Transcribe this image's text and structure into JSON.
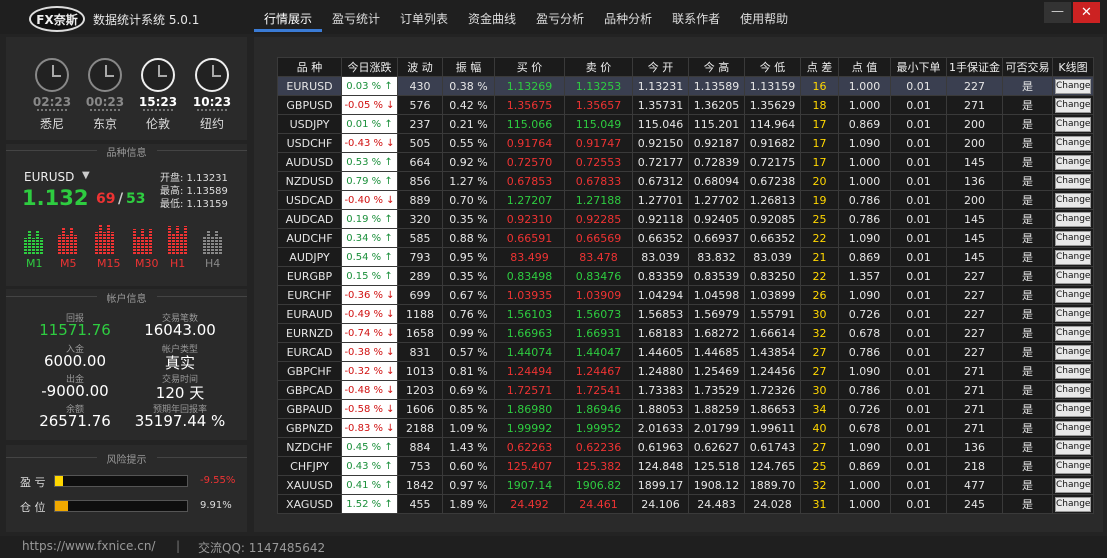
{
  "app": {
    "logo": "FX奈斯",
    "title": "数据统计系统 5.0.1"
  },
  "nav": [
    "行情展示",
    "盈亏统计",
    "订单列表",
    "资金曲线",
    "盈亏分析",
    "品种分析",
    "联系作者",
    "使用帮助"
  ],
  "window_buttons": {
    "minimize": "—",
    "close": "✕"
  },
  "clocks": [
    {
      "time": "02:23",
      "city": "悉尼",
      "active": false
    },
    {
      "time": "00:23",
      "city": "东京",
      "active": false
    },
    {
      "time": "15:23",
      "city": "伦敦",
      "active": true
    },
    {
      "time": "10:23",
      "city": "纽约",
      "active": true
    }
  ],
  "symbol_panel": {
    "title": "品种信息",
    "symbol": "EURUSD",
    "price_main": "1.132",
    "price_r1": "69",
    "price_sep": "/",
    "price_r2": "53",
    "open": "开盘: 1.13231",
    "high": "最高: 1.13589",
    "low": "最低: 1.13159",
    "timeframes": [
      "M1",
      "M5",
      "M15",
      "M30",
      "H1",
      "H4"
    ],
    "tf_colors": [
      "#2ecc40",
      "#e33",
      "#e33",
      "#e33",
      "#e33",
      "#888"
    ]
  },
  "account": {
    "title": "帐户信息",
    "items": [
      {
        "label": "回报",
        "value": "11571.76",
        "color": "#2ecc40"
      },
      {
        "label": "交易笔数",
        "value": "16043.00",
        "color": "#fff"
      },
      {
        "label": "入金",
        "value": "6000.00",
        "color": "#fff"
      },
      {
        "label": "帐户类型",
        "value": "真实",
        "color": "#fff"
      },
      {
        "label": "出金",
        "value": "-9000.00",
        "color": "#fff"
      },
      {
        "label": "交易时间",
        "value": "120 天",
        "color": "#fff"
      },
      {
        "label": "余额",
        "value": "26571.76",
        "color": "#fff"
      },
      {
        "label": "预期年回报率",
        "value": "35197.44 %",
        "color": "#fff"
      }
    ]
  },
  "risk": {
    "title": "风险提示",
    "profit_label": "盈 亏",
    "profit_value": "-9.55%",
    "profit_level": 0.06,
    "position_label": "仓 位",
    "position_value": "9.91%",
    "position_level": 0.0991
  },
  "table": {
    "headers": [
      "品 种",
      "今日涨跌",
      "波 动",
      "振 幅",
      "买 价",
      "卖 价",
      "今 开",
      "今 高",
      "今 低",
      "点 差",
      "点 值",
      "最小下单",
      "1手保证金",
      "可否交易",
      "K线图"
    ],
    "change_label": "Change",
    "rows": [
      [
        "EURUSD",
        "0.03 % ↑",
        "up",
        "430",
        "0.38 %",
        "1.13269",
        "1.13253",
        "1.13231",
        "1.13589",
        "1.13159",
        "16",
        "1.000",
        "0.01",
        "227",
        "是"
      ],
      [
        "GBPUSD",
        "-0.05 % ↓",
        "dn",
        "576",
        "0.42 %",
        "1.35675",
        "1.35657",
        "1.35731",
        "1.36205",
        "1.35629",
        "18",
        "1.000",
        "0.01",
        "271",
        "是"
      ],
      [
        "USDJPY",
        "0.01 % ↑",
        "up",
        "237",
        "0.21 %",
        "115.066",
        "115.049",
        "115.046",
        "115.201",
        "114.964",
        "17",
        "0.869",
        "0.01",
        "200",
        "是"
      ],
      [
        "USDCHF",
        "-0.43 % ↓",
        "dn",
        "505",
        "0.55 %",
        "0.91764",
        "0.91747",
        "0.92150",
        "0.92187",
        "0.91682",
        "17",
        "1.090",
        "0.01",
        "200",
        "是"
      ],
      [
        "AUDUSD",
        "0.53 % ↑",
        "dn",
        "664",
        "0.92 %",
        "0.72570",
        "0.72553",
        "0.72177",
        "0.72839",
        "0.72175",
        "17",
        "1.000",
        "0.01",
        "145",
        "是"
      ],
      [
        "NZDUSD",
        "0.79 % ↑",
        "dn",
        "856",
        "1.27 %",
        "0.67853",
        "0.67833",
        "0.67312",
        "0.68094",
        "0.67238",
        "20",
        "1.000",
        "0.01",
        "136",
        "是"
      ],
      [
        "USDCAD",
        "-0.40 % ↓",
        "up",
        "889",
        "0.70 %",
        "1.27207",
        "1.27188",
        "1.27701",
        "1.27702",
        "1.26813",
        "19",
        "0.786",
        "0.01",
        "200",
        "是"
      ],
      [
        "AUDCAD",
        "0.19 % ↑",
        "dn",
        "320",
        "0.35 %",
        "0.92310",
        "0.92285",
        "0.92118",
        "0.92405",
        "0.92085",
        "25",
        "0.786",
        "0.01",
        "145",
        "是"
      ],
      [
        "AUDCHF",
        "0.34 % ↑",
        "dn",
        "585",
        "0.88 %",
        "0.66591",
        "0.66569",
        "0.66352",
        "0.66937",
        "0.66352",
        "22",
        "1.090",
        "0.01",
        "145",
        "是"
      ],
      [
        "AUDJPY",
        "0.54 % ↑",
        "dn",
        "793",
        "0.95 %",
        "83.499",
        "83.478",
        "83.039",
        "83.832",
        "83.039",
        "21",
        "0.869",
        "0.01",
        "145",
        "是"
      ],
      [
        "EURGBP",
        "0.15 % ↑",
        "up",
        "289",
        "0.35 %",
        "0.83498",
        "0.83476",
        "0.83359",
        "0.83539",
        "0.83250",
        "22",
        "1.357",
        "0.01",
        "227",
        "是"
      ],
      [
        "EURCHF",
        "-0.36 % ↓",
        "dn",
        "699",
        "0.67 %",
        "1.03935",
        "1.03909",
        "1.04294",
        "1.04598",
        "1.03899",
        "26",
        "1.090",
        "0.01",
        "227",
        "是"
      ],
      [
        "EURAUD",
        "-0.49 % ↓",
        "up",
        "1188",
        "0.76 %",
        "1.56103",
        "1.56073",
        "1.56853",
        "1.56979",
        "1.55791",
        "30",
        "0.726",
        "0.01",
        "227",
        "是"
      ],
      [
        "EURNZD",
        "-0.74 % ↓",
        "up",
        "1658",
        "0.99 %",
        "1.66963",
        "1.66931",
        "1.68183",
        "1.68272",
        "1.66614",
        "32",
        "0.678",
        "0.01",
        "227",
        "是"
      ],
      [
        "EURCAD",
        "-0.38 % ↓",
        "up",
        "831",
        "0.57 %",
        "1.44074",
        "1.44047",
        "1.44605",
        "1.44685",
        "1.43854",
        "27",
        "0.786",
        "0.01",
        "227",
        "是"
      ],
      [
        "GBPCHF",
        "-0.32 % ↓",
        "dn",
        "1013",
        "0.81 %",
        "1.24494",
        "1.24467",
        "1.24880",
        "1.25469",
        "1.24456",
        "27",
        "1.090",
        "0.01",
        "271",
        "是"
      ],
      [
        "GBPCAD",
        "-0.48 % ↓",
        "dn",
        "1203",
        "0.69 %",
        "1.72571",
        "1.72541",
        "1.73383",
        "1.73529",
        "1.72326",
        "30",
        "0.786",
        "0.01",
        "271",
        "是"
      ],
      [
        "GBPAUD",
        "-0.58 % ↓",
        "up",
        "1606",
        "0.85 %",
        "1.86980",
        "1.86946",
        "1.88053",
        "1.88259",
        "1.86653",
        "34",
        "0.726",
        "0.01",
        "271",
        "是"
      ],
      [
        "GBPNZD",
        "-0.83 % ↓",
        "up",
        "2188",
        "1.09 %",
        "1.99992",
        "1.99952",
        "2.01633",
        "2.01799",
        "1.99611",
        "40",
        "0.678",
        "0.01",
        "271",
        "是"
      ],
      [
        "NZDCHF",
        "0.45 % ↑",
        "dn",
        "884",
        "1.43 %",
        "0.62263",
        "0.62236",
        "0.61963",
        "0.62627",
        "0.61743",
        "27",
        "1.090",
        "0.01",
        "136",
        "是"
      ],
      [
        "CHFJPY",
        "0.43 % ↑",
        "dn",
        "753",
        "0.60 %",
        "125.407",
        "125.382",
        "124.848",
        "125.518",
        "124.765",
        "25",
        "0.869",
        "0.01",
        "218",
        "是"
      ],
      [
        "XAUUSD",
        "0.41 % ↑",
        "up",
        "1842",
        "0.97 %",
        "1907.14",
        "1906.82",
        "1899.17",
        "1908.12",
        "1889.70",
        "32",
        "1.000",
        "0.01",
        "477",
        "是"
      ],
      [
        "XAGUSD",
        "1.52 % ↑",
        "dn",
        "455",
        "1.89 %",
        "24.492",
        "24.461",
        "24.106",
        "24.483",
        "24.028",
        "31",
        "1.000",
        "0.01",
        "245",
        "是"
      ]
    ]
  },
  "statusbar": {
    "url": "https://www.fxnice.cn/",
    "sep": "|",
    "qq": "交流QQ: 1147485642"
  }
}
